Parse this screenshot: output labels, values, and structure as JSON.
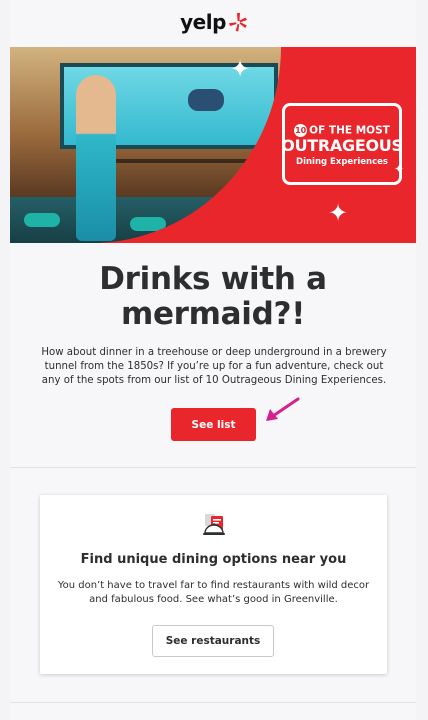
{
  "brand": {
    "logo_text": "yelp",
    "accent": "#e9262c"
  },
  "hero": {
    "badge_number": "10",
    "badge_top": "OF THE MOST",
    "badge_main": "OUTRAGEOUS",
    "badge_sub": "Dining Experiences"
  },
  "article": {
    "headline": "Drinks with a mermaid?!",
    "body": "How about dinner in a treehouse or deep underground in a brewery tunnel from the 1850s? If you’re up for a fun adventure, check out any of the spots from our list of 10 Outrageous Dining Experiences.",
    "cta_label": "See list"
  },
  "promo": {
    "icon": "restaurant-cloche-icon",
    "title": "Find unique dining options near you",
    "body": "You don’t have to travel far to find restaurants with wild decor and fabulous food. See what’s good in Greenville.",
    "cta_label": "See restaurants"
  }
}
